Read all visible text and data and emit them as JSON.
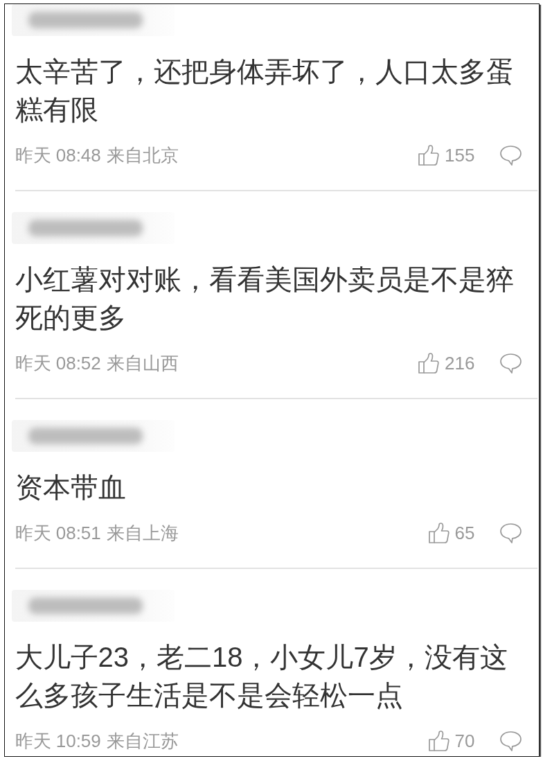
{
  "comments": [
    {
      "text": "太辛苦了，还把身体弄坏了，人口太多蛋糕有限",
      "time": "昨天 08:48",
      "location": "来自北京",
      "likes": "155"
    },
    {
      "text": "小红薯对对账，看看美国外卖员是不是猝死的更多",
      "time": "昨天 08:52",
      "location": "来自山西",
      "likes": "216"
    },
    {
      "text": "资本带血",
      "time": "昨天 08:51",
      "location": "来自上海",
      "likes": "65"
    },
    {
      "text": "大儿子23，老二18，小女儿7岁，没有这么多孩子生活是不是会轻松一点",
      "time": "昨天 10:59",
      "location": "来自江苏",
      "likes": "70"
    }
  ]
}
